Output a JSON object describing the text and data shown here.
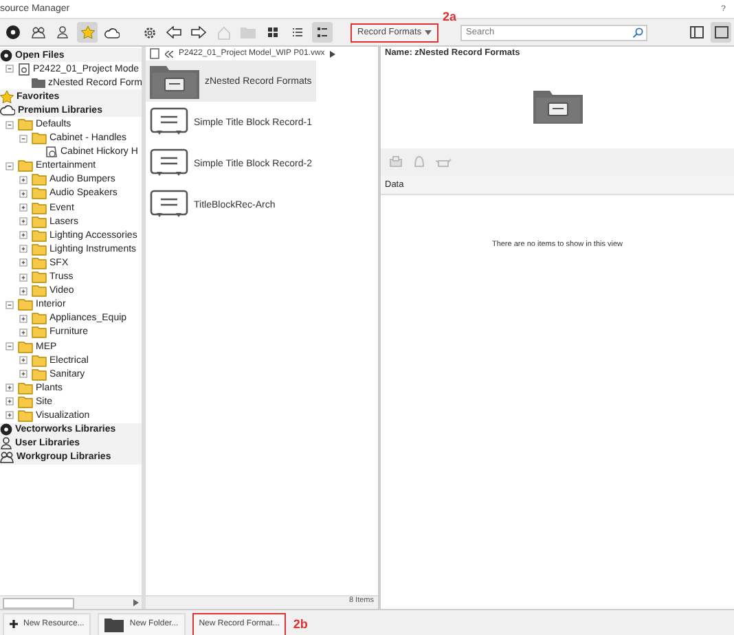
{
  "window": {
    "title": "source Manager",
    "help": "?"
  },
  "toolbar": {
    "view_modes": [
      {
        "kind": "grid",
        "selected": false
      },
      {
        "kind": "list",
        "selected": false
      },
      {
        "kind": "details",
        "selected": true
      }
    ]
  },
  "tree": [
    {
      "label": "Open Files",
      "kind": "open-files",
      "children": [
        {
          "label": "P2422_01_Project Mode",
          "kind": "file",
          "expanded": true,
          "children": [
            {
              "label": "zNested Record Form",
              "kind": "record-folder"
            }
          ]
        }
      ]
    },
    {
      "label": "Favorites",
      "kind": "favorites"
    },
    {
      "label": "Premium Libraries",
      "kind": "cloud",
      "children": [
        {
          "label": "Defaults",
          "kind": "folder",
          "expanded": true,
          "children": [
            {
              "label": "Cabinet - Handles",
              "kind": "folder",
              "expanded": true,
              "children": [
                {
                  "label": "Cabinet Hickory H",
                  "kind": "resource"
                }
              ]
            }
          ]
        },
        {
          "label": "Entertainment",
          "kind": "folder",
          "expanded": true,
          "children": [
            {
              "label": "Audio Bumpers",
              "kind": "folder",
              "expanded": false
            },
            {
              "label": "Audio Speakers",
              "kind": "folder",
              "expanded": false
            },
            {
              "label": "Event",
              "kind": "folder",
              "expanded": false
            },
            {
              "label": "Lasers",
              "kind": "folder",
              "expanded": false
            },
            {
              "label": "Lighting Accessories",
              "kind": "folder",
              "expanded": false
            },
            {
              "label": "Lighting Instruments",
              "kind": "folder",
              "expanded": false
            },
            {
              "label": "SFX",
              "kind": "folder",
              "expanded": false
            },
            {
              "label": "Truss",
              "kind": "folder",
              "expanded": false
            },
            {
              "label": "Video",
              "kind": "folder",
              "expanded": false
            }
          ]
        },
        {
          "label": "Interior",
          "kind": "folder",
          "expanded": true,
          "children": [
            {
              "label": "Appliances_Equip",
              "kind": "folder",
              "expanded": false
            },
            {
              "label": "Furniture",
              "kind": "folder",
              "expanded": false
            }
          ]
        },
        {
          "label": "MEP",
          "kind": "folder",
          "expanded": true,
          "children": [
            {
              "label": "Electrical",
              "kind": "folder",
              "expanded": false
            },
            {
              "label": "Sanitary",
              "kind": "folder",
              "expanded": false
            }
          ]
        },
        {
          "label": "Plants",
          "kind": "folder",
          "expanded": false
        },
        {
          "label": "Site",
          "kind": "folder",
          "expanded": false
        },
        {
          "label": "Visualization",
          "kind": "folder",
          "expanded": false
        }
      ]
    },
    {
      "label": "Vectorworks Libraries",
      "kind": "vectorworks"
    },
    {
      "label": "User Libraries",
      "kind": "user"
    },
    {
      "label": "Workgroup Libraries",
      "kind": "workgroup"
    }
  ],
  "browser": {
    "path": "P2422_01_Project Model_WIP P01.vwx",
    "items": [
      {
        "label": "zNested Record Formats",
        "kind": "folder",
        "selected": true
      },
      {
        "label": "Simple Title Block Record-1",
        "kind": "record",
        "selected": false
      },
      {
        "label": "Simple Title Block Record-2",
        "kind": "record",
        "selected": false
      },
      {
        "label": "TitleBlockRec-Arch",
        "kind": "record",
        "selected": false
      }
    ],
    "count": "8 Items"
  },
  "filter": {
    "value": "Record Formats",
    "annotation": "2a"
  },
  "search": {
    "placeholder": "Search"
  },
  "preview": {
    "name": "Name: zNested Record Formats"
  },
  "data": {
    "header": "Data",
    "empty_message": "There are no items to show in this view"
  },
  "buttons": [
    {
      "label": "New Resource...",
      "kind": "plus"
    },
    {
      "label": "New Folder...",
      "kind": "folder"
    },
    {
      "label": "New Record Format...",
      "kind": "plain",
      "annotation": "2b"
    }
  ]
}
